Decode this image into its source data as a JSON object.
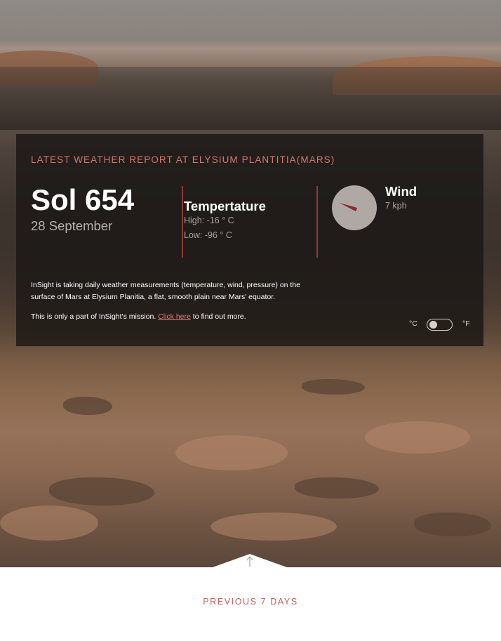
{
  "header": {
    "title": "LATEST WEATHER REPORT AT ELYSIUM PLANTITIA(MARS)"
  },
  "current": {
    "sol": "Sol 654",
    "date": "28 September"
  },
  "temperature": {
    "heading": "Tempertature",
    "high": "High: -16 ° C",
    "low": "Low: -96 ° C"
  },
  "wind": {
    "heading": "Wind",
    "speed": "7 kph",
    "direction_icon": "wind-direction-compass"
  },
  "info": {
    "description": "InSight is taking daily weather measurements (temperature, wind, pressure) on the surface of Mars at Elysium Planitia, a flat, smooth plain near Mars' equator.",
    "mission_prefix": "This is only a part of InSight's mission.",
    "mission_link": "Click here",
    "mission_suffix": "to find out more."
  },
  "units": {
    "celsius": "°C",
    "fahrenheit": "°F",
    "selected": "celsius"
  },
  "footer": {
    "previous_days": "PREVIOUS 7 DAYS",
    "toggle_icon": "arrow-up-icon"
  },
  "colors": {
    "accent": "#d9756a",
    "panel_background": "#1c1816",
    "divider": "#8e3b36",
    "compass_background": "#b0a8a4",
    "compass_needle": "#8e2a24"
  }
}
